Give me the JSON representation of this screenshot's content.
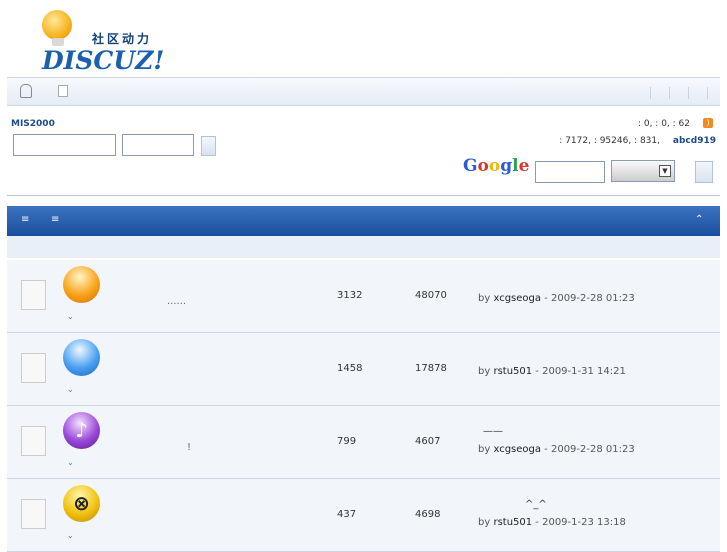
{
  "logo": {
    "cn": "社区动力",
    "en": "DISCUZ!"
  },
  "site": {
    "name": "MIS2000"
  },
  "stats": {
    "line1": ": 0,  : 0,  : 62",
    "line2": ": 7172,  : 95246,  : 831,",
    "user": "abcd919"
  },
  "google": {
    "label": "Google"
  },
  "threads": [
    {
      "mid": "......",
      "replies": "3132",
      "views": "48070",
      "extra": "",
      "by": "by",
      "author": "xcgseoga",
      "date": " - 2009-2-28 01:23"
    },
    {
      "mid": "",
      "replies": "1458",
      "views": "17878",
      "extra": "",
      "by": "by",
      "author": "rstu501",
      "date": " - 2009-1-31 14:21"
    },
    {
      "mid": "!",
      "replies": "799",
      "views": "4607",
      "extra": "——",
      "by": "by",
      "author": "xcgseoga",
      "date": " - 2009-2-28 01:23"
    },
    {
      "mid": "",
      "replies": "437",
      "views": "4698",
      "extra": "^_^",
      "by": "by",
      "author": "rstu501",
      "date": " - 2009-1-23 13:18"
    }
  ],
  "colors": {
    "header": "#1a4e9c",
    "accent": "#1d4a88"
  }
}
